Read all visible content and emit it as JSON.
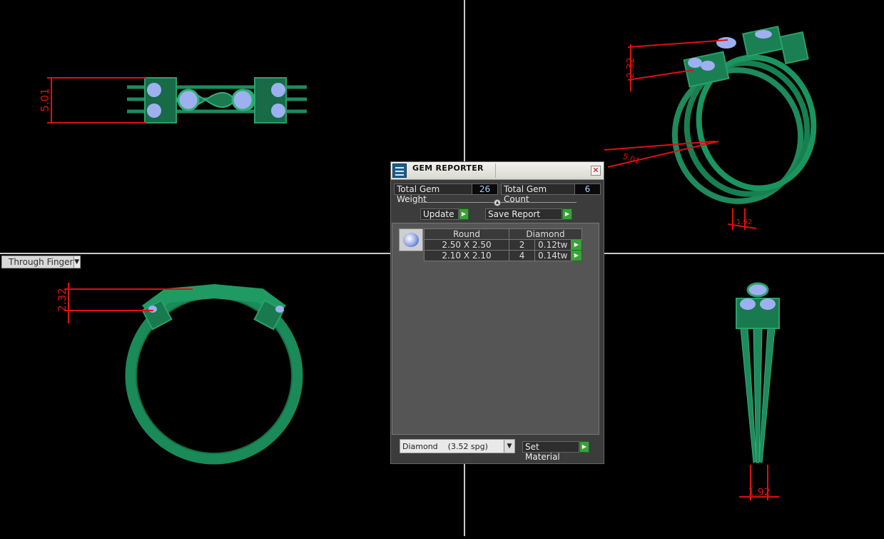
{
  "viewports": {
    "top_left": {
      "dimension": "5.01"
    },
    "top_right": {
      "dimensions": [
        "2.32",
        "5.01",
        "1.92"
      ]
    },
    "bottom_left": {
      "dimension": "2.32",
      "view_dropdown": "Through Finger"
    },
    "bottom_right": {
      "dimension": "1.92"
    }
  },
  "gem_reporter": {
    "title": "GEM REPORTER",
    "total_gem_weight_label": "Total Gem Weight",
    "total_gem_weight_value": "26",
    "total_gem_count_label": "Total Gem Count",
    "total_gem_count_value": "6",
    "update_label": "Update",
    "save_report_label": "Save Report",
    "gem_table": {
      "headers": [
        "Round",
        "Diamond"
      ],
      "rows": [
        {
          "size": "2.50 X 2.50",
          "count": "2",
          "weight": "0.12tw"
        },
        {
          "size": "2.10 X 2.10",
          "count": "4",
          "weight": "0.14tw"
        }
      ]
    },
    "material_select": "Diamond    (3.52 spg)",
    "set_material_label": "Set Material"
  },
  "colors": {
    "metal": "#1f8a5c",
    "gem": "#9fb0f0",
    "dimension": "#e01010",
    "accent_button": "#3aa23a"
  }
}
